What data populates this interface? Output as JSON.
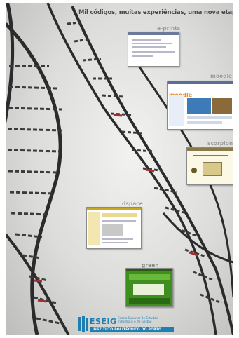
{
  "title": "Mil códigos, muitas experiências, uma nova etapa",
  "labels": {
    "eprints": "e-prints",
    "moodle": "moodle",
    "scorpion": "scorpion",
    "dspace": "dspace",
    "green": "green"
  },
  "moodle_logo": "moodle",
  "footer": {
    "acronym": "ESEIG",
    "subtitle": "Escola Superior de Estudos Industriais e de Gestão",
    "institute": "INSTITUTO POLITÉCNICO DO PORTO"
  },
  "colors": {
    "helix": "#2b2b2b",
    "accent_red": "#a03030",
    "logo_blue": "#1e7fb0",
    "moodle_orange": "#f08a24",
    "green_site": "#3f8f1f"
  }
}
